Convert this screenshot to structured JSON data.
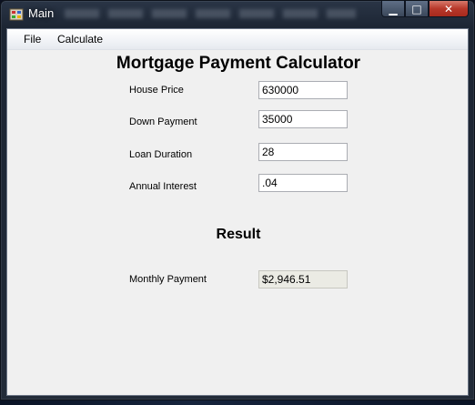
{
  "window": {
    "title": "Main"
  },
  "menu": {
    "file": "File",
    "calculate": "Calculate"
  },
  "form": {
    "heading": "Mortgage Payment Calculator",
    "fields": [
      {
        "label": "House Price",
        "value": "630000"
      },
      {
        "label": "Down Payment",
        "value": "35000"
      },
      {
        "label": "Loan Duration",
        "value": "28"
      },
      {
        "label": "Annual Interest",
        "value": ".04"
      }
    ]
  },
  "result": {
    "heading": "Result",
    "label": "Monthly Payment",
    "value": "$2,946.51"
  },
  "colors": {
    "accent_close": "#c4473a",
    "client_bg": "#f0f0f0"
  }
}
